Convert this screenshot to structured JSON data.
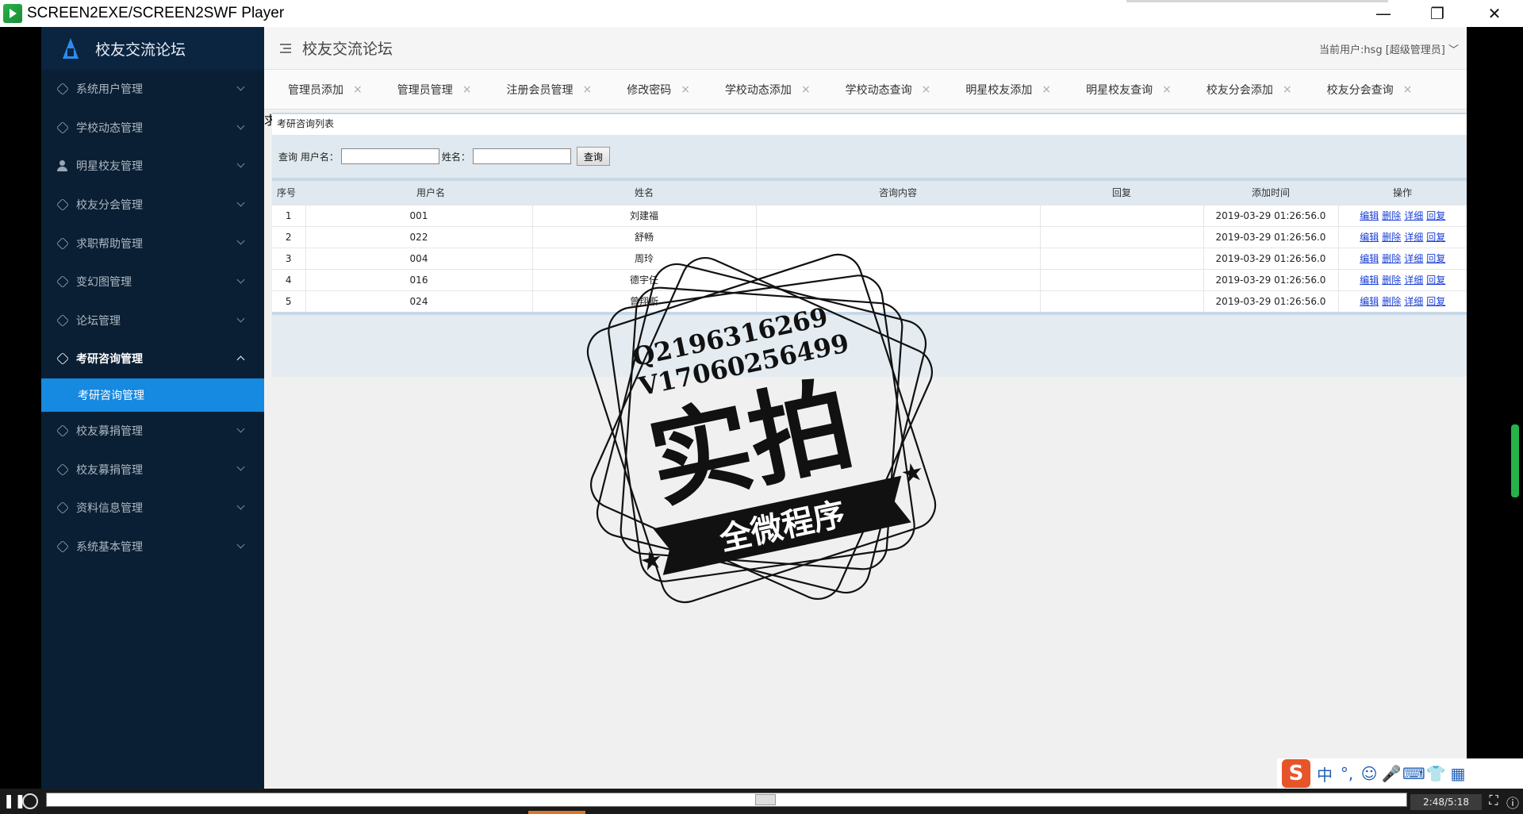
{
  "window": {
    "title": "SCREEN2EXE/SCREEN2SWF Player",
    "minimize": "—",
    "restore": "❐",
    "close": "✕"
  },
  "sidebar": {
    "logo_text": "校友交流论坛",
    "items": [
      {
        "label": "系统用户管理"
      },
      {
        "label": "学校动态管理"
      },
      {
        "label": "明星校友管理"
      },
      {
        "label": "校友分会管理"
      },
      {
        "label": "求职帮助管理"
      },
      {
        "label": "变幻图管理"
      },
      {
        "label": "论坛管理"
      },
      {
        "label": "考研咨询管理"
      },
      {
        "label": "校友募捐管理"
      },
      {
        "label": "校友募捐管理"
      },
      {
        "label": "资料信息管理"
      },
      {
        "label": "系统基本管理"
      }
    ],
    "active_sub": "考研咨询管理"
  },
  "header": {
    "title": "校友交流论坛",
    "current_user": "当前用户:hsg [超级管理员] ﹀"
  },
  "tabs": [
    {
      "label": "管理员添加"
    },
    {
      "label": "管理员管理"
    },
    {
      "label": "注册会员管理"
    },
    {
      "label": "修改密码"
    },
    {
      "label": "学校动态添加"
    },
    {
      "label": "学校动态查询"
    },
    {
      "label": "明星校友添加"
    },
    {
      "label": "明星校友查询"
    },
    {
      "label": "校友分会添加"
    },
    {
      "label": "校友分会查询"
    }
  ],
  "tab_more": "求 ﹀",
  "tab_close": "×",
  "panel": {
    "title": "考研咨询列表",
    "search_label_user": "查询 用户名：",
    "search_label_name": "姓名：",
    "search_button": "查询"
  },
  "table": {
    "headers": [
      "序号",
      "用户名",
      "姓名",
      "咨询内容",
      "回复",
      "添加时间",
      "操作"
    ],
    "rows": [
      {
        "no": "1",
        "user": "001",
        "name": "刘建福",
        "content": "",
        "reply": "",
        "time": "2019-03-29 01:26:56.0"
      },
      {
        "no": "2",
        "user": "022",
        "name": "舒畅",
        "content": "",
        "reply": "",
        "time": "2019-03-29 01:26:56.0"
      },
      {
        "no": "3",
        "user": "004",
        "name": "周玲",
        "content": "",
        "reply": "",
        "time": "2019-03-29 01:26:56.0"
      },
      {
        "no": "4",
        "user": "016",
        "name": "德宇任",
        "content": "",
        "reply": "",
        "time": "2019-03-29 01:26:56.0"
      },
      {
        "no": "5",
        "user": "024",
        "name": "曾翔斯",
        "content": "",
        "reply": "",
        "time": "2019-03-29 01:26:56.0"
      }
    ],
    "ops": {
      "edit": "编辑",
      "delete": "删除",
      "detail": "详细",
      "reply": "回复"
    }
  },
  "watermark": {
    "line1": "Q2196316269",
    "line2": "V17060256499",
    "main": "实拍",
    "banner": "全微程序"
  },
  "ime": {
    "logo": "S",
    "items": [
      "中",
      "°,",
      "☺",
      "🎤",
      "⌨",
      "👕",
      "▦"
    ]
  },
  "player": {
    "pause": "❚❚",
    "time": "2:48/5:18"
  }
}
